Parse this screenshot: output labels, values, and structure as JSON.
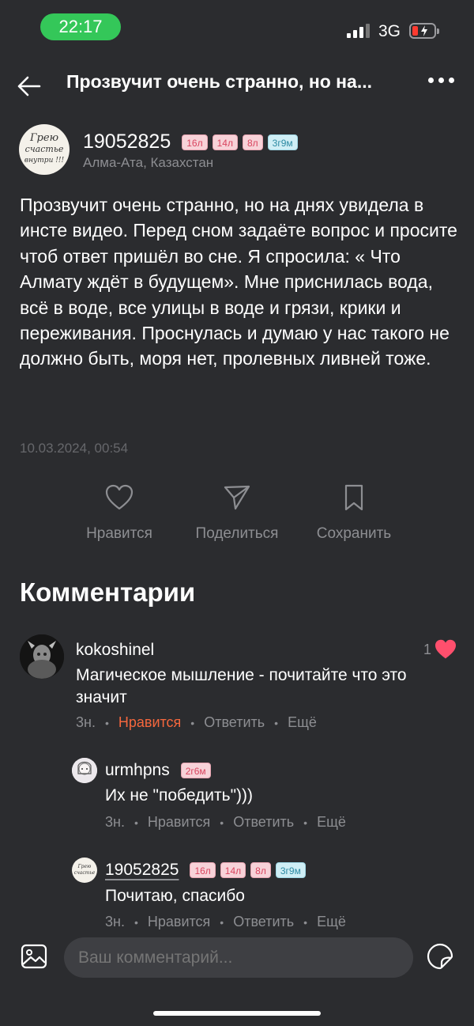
{
  "status_bar": {
    "time": "22:17",
    "network": "3G"
  },
  "header": {
    "title": "Прозвучит очень странно, но на..."
  },
  "author": {
    "avatar_text": [
      "Грею",
      "счастье",
      "внутри !!!"
    ],
    "username": "19052825",
    "badges": [
      "16л",
      "14л",
      "8л",
      "3г9м"
    ],
    "location": "Алма-Ата, Казахстан"
  },
  "post": {
    "text": "Прозвучит очень странно, но на днях увидела в инсте видео. Перед сном задаёте вопрос и просите чтоб ответ пришёл во сне. Я спросила: « Что Алмату ждёт в будущем». Мне приснилась вода, всё в воде, все улицы в воде и грязи, крики и переживания. Проснулась и думаю у нас такого не должно быть, моря нет, пролевных ливней тоже.",
    "date": "10.03.2024, 00:54"
  },
  "actions": {
    "like": "Нравится",
    "share": "Поделиться",
    "save": "Сохранить"
  },
  "comments_heading": "Комментарии",
  "comments": [
    {
      "username": "kokoshinel",
      "text": "Магическое мышление - почитайте что это значит",
      "time": "3н.",
      "like": "Нравится",
      "reply": "Ответить",
      "more": "Ещё",
      "like_count": "1",
      "liked": true
    },
    {
      "username": "urmhpns",
      "badge": "2г6м",
      "text": "Их не \"победить\")))",
      "time": "3н.",
      "like": "Нравится",
      "reply": "Ответить",
      "more": "Ещё"
    },
    {
      "username": "19052825",
      "badges": [
        "16л",
        "14л",
        "8л",
        "3г9м"
      ],
      "text": "Почитаю, спасибо",
      "time": "3н.",
      "like": "Нравится",
      "reply": "Ответить",
      "more": "Ещё"
    }
  ],
  "composer": {
    "placeholder": "Ваш комментарий..."
  },
  "colors": {
    "background": "#2b2c2f",
    "accent_like": "#f5673d",
    "heart": "#ff4f6d",
    "status_green": "#34c759"
  }
}
